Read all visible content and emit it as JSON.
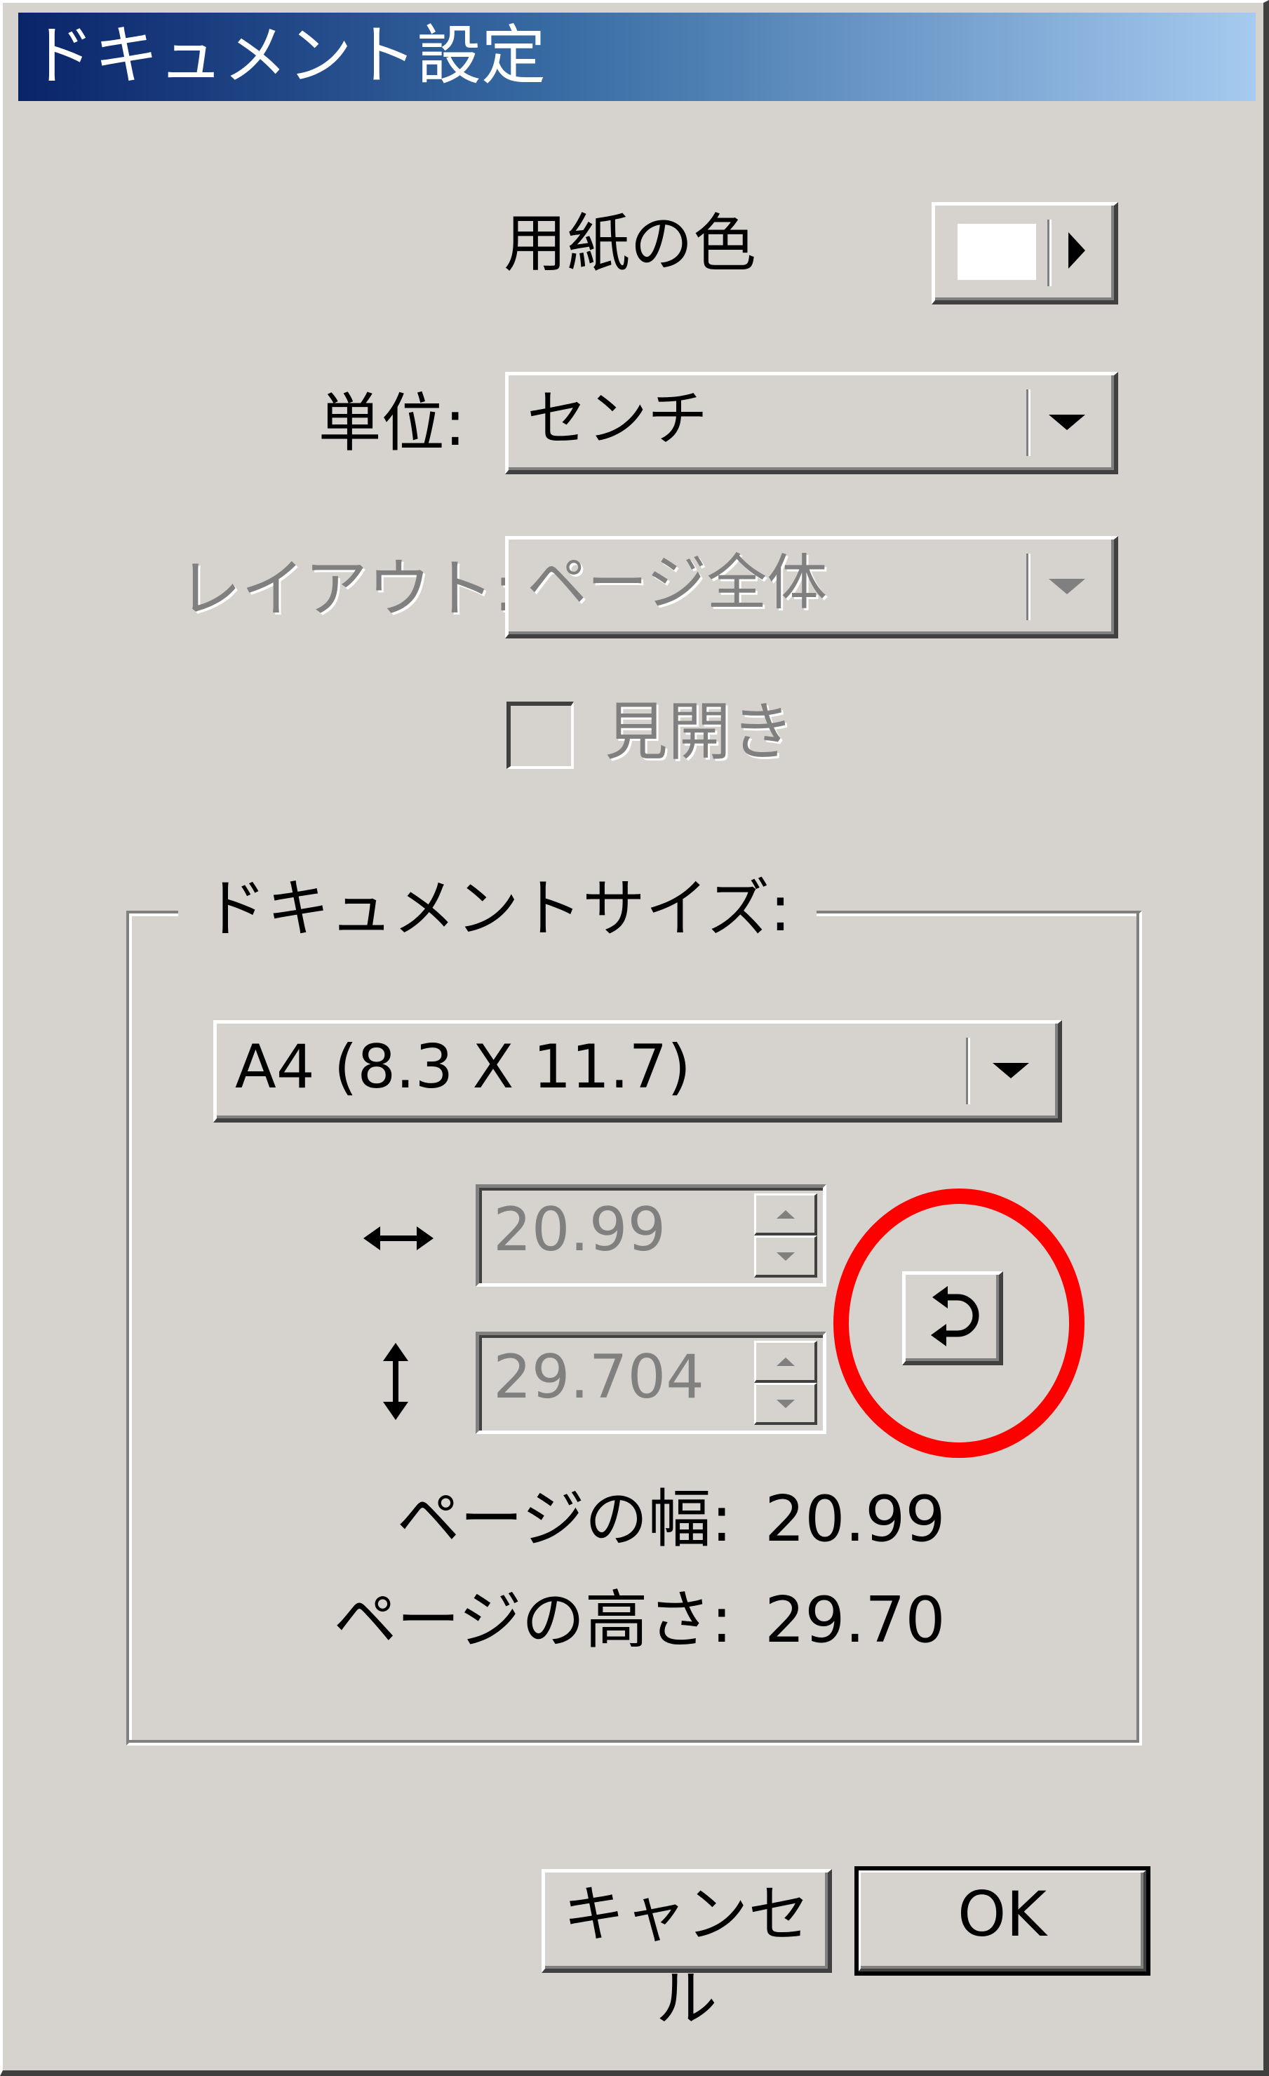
{
  "window": {
    "title": "ドキュメント設定"
  },
  "paper_color": {
    "label": "用紙の色",
    "swatch_color": "#ffffff"
  },
  "units": {
    "label": "単位:",
    "value": "センチ"
  },
  "layout": {
    "label": "レイアウト:",
    "value": "ページ全体",
    "enabled": false
  },
  "spread": {
    "label": "見開き",
    "checked": false,
    "enabled": false
  },
  "document_size": {
    "legend": "ドキュメントサイズ:",
    "preset": "A4 (8.3 X 11.7)",
    "width_icon": "horizontal-arrows-icon",
    "height_icon": "vertical-arrows-icon",
    "width_value": "20.99",
    "height_value": "29.704",
    "swap_icon": "swap-orientation-icon",
    "page_width_label": "ページの幅:",
    "page_width_value": "20.99",
    "page_height_label": "ページの高さ:",
    "page_height_value": "29.70"
  },
  "highlight_color": "#ff0000",
  "buttons": {
    "cancel": "キャンセル",
    "ok": "OK"
  }
}
